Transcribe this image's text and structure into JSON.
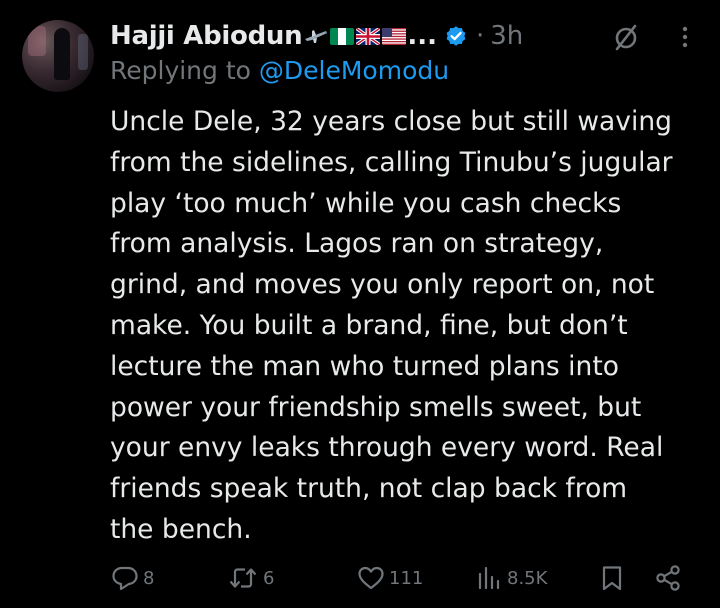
{
  "tweet": {
    "display_name": "Hajji Abiodun",
    "ellipsis": "...",
    "dot": "·",
    "time": "3h",
    "flags": [
      "airplane",
      "nigeria",
      "uk",
      "usa"
    ],
    "verified_color": "#1d9bf0",
    "replying_prefix": "Replying to ",
    "replying_handle": "@DeleMomodu",
    "body": "Uncle Dele, 32 years close but still waving\nfrom the sidelines, calling Tinubu’s jugular\nplay ‘too much’ while you cash checks\nfrom analysis. Lagos ran on strategy,\ngrind, and moves you only report on, not\nmake. You built a brand, fine, but don’t\nlecture the man who turned plans into\npower your friendship smells sweet, but\nyour envy leaks through every word. Real\nfriends speak truth, not clap back from\nthe bench."
  },
  "actions": {
    "replies": "8",
    "reposts": "6",
    "likes": "111",
    "views": "8.5K"
  },
  "colors": {
    "background": "#000000",
    "text": "#e7e9ea",
    "muted": "#71767b",
    "accent": "#1d9bf0"
  },
  "icons": {
    "reply": "reply-icon",
    "repost": "repost-icon",
    "like": "heart-icon",
    "views": "views-icon",
    "bookmark": "bookmark-icon",
    "share": "share-icon",
    "mute": "mute-icon",
    "more": "more-icon",
    "verified": "verified-icon"
  }
}
